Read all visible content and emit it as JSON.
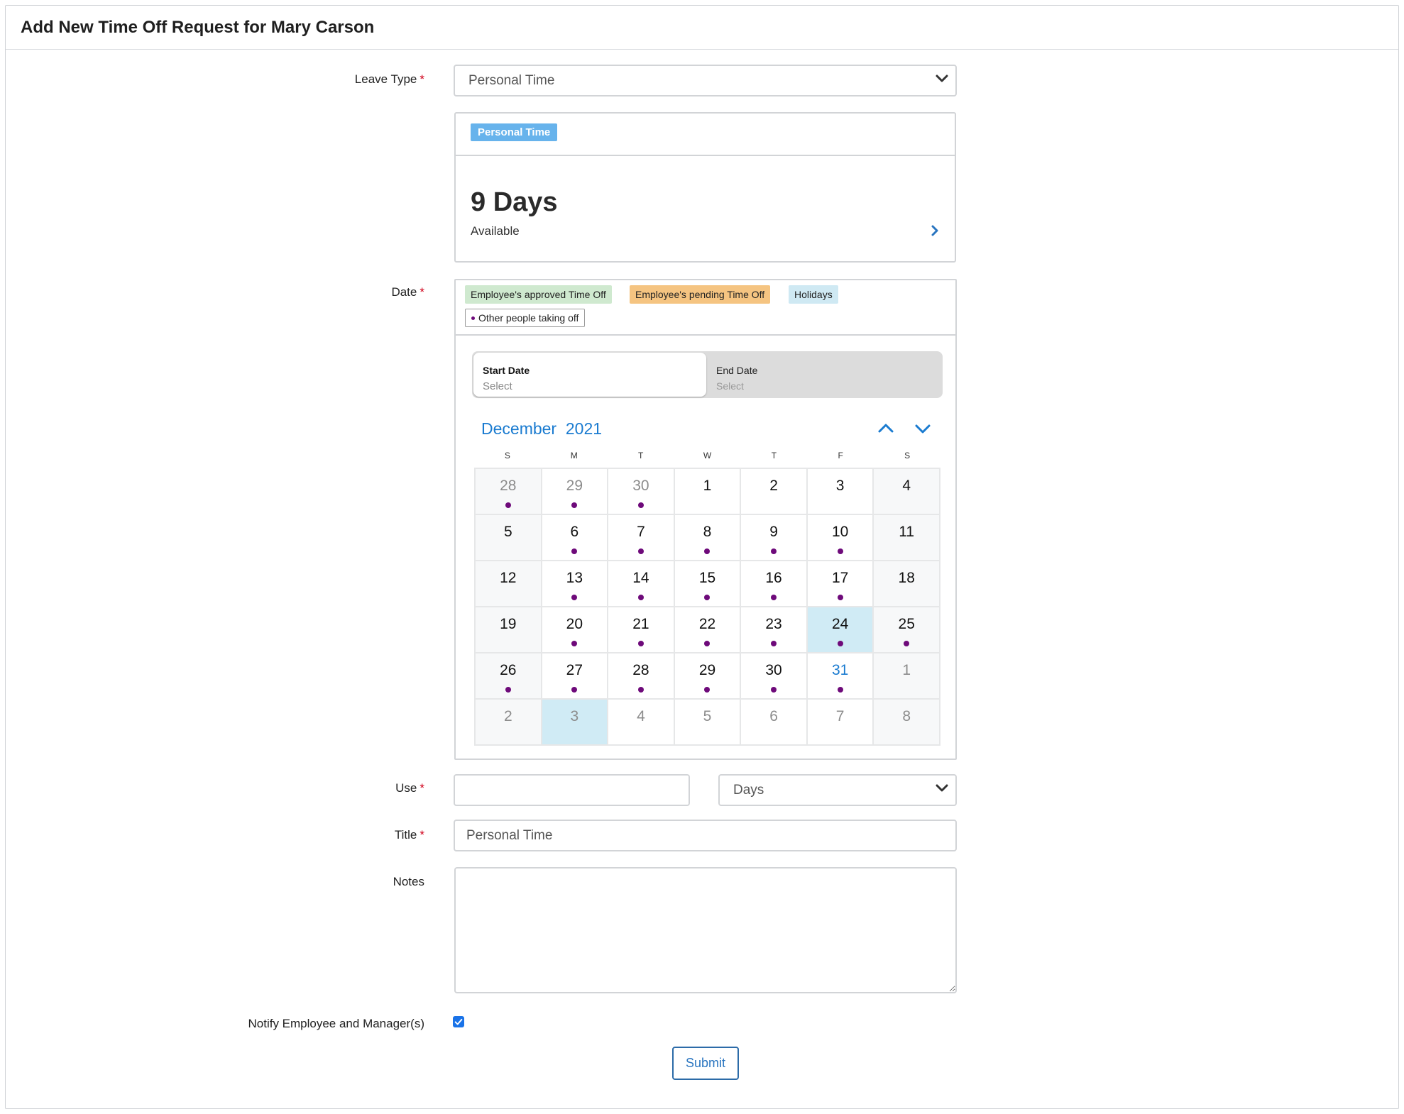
{
  "header": {
    "title": "Add New Time Off Request for Mary Carson"
  },
  "leave_type": {
    "label": "Leave Type",
    "required_mark": "*",
    "selected": "Personal Time"
  },
  "balance": {
    "badge": "Personal Time",
    "amount": "9 Days",
    "caption": "Available"
  },
  "date": {
    "label": "Date",
    "required_mark": "*",
    "legend": {
      "approved": "Employee's approved Time Off",
      "pending": "Employee's pending Time Off",
      "holidays": "Holidays",
      "others": "Other people taking off"
    },
    "start": {
      "label": "Start Date",
      "value": "Select"
    },
    "end": {
      "label": "End Date",
      "value": "Select"
    },
    "month": "December",
    "year": "2021",
    "weekdays": [
      "S",
      "M",
      "T",
      "W",
      "T",
      "F",
      "S"
    ],
    "days": [
      {
        "d": "28",
        "other": true,
        "dot": true
      },
      {
        "d": "29",
        "other": true,
        "dot": true
      },
      {
        "d": "30",
        "other": true,
        "dot": true
      },
      {
        "d": "1",
        "dot": false
      },
      {
        "d": "2",
        "dot": false
      },
      {
        "d": "3",
        "dot": false
      },
      {
        "d": "4",
        "dot": false
      },
      {
        "d": "5",
        "dot": false
      },
      {
        "d": "6",
        "dot": true
      },
      {
        "d": "7",
        "dot": true
      },
      {
        "d": "8",
        "dot": true
      },
      {
        "d": "9",
        "dot": true
      },
      {
        "d": "10",
        "dot": true
      },
      {
        "d": "11",
        "dot": false
      },
      {
        "d": "12",
        "dot": false
      },
      {
        "d": "13",
        "dot": true
      },
      {
        "d": "14",
        "dot": true
      },
      {
        "d": "15",
        "dot": true
      },
      {
        "d": "16",
        "dot": true
      },
      {
        "d": "17",
        "dot": true
      },
      {
        "d": "18",
        "dot": false
      },
      {
        "d": "19",
        "dot": false
      },
      {
        "d": "20",
        "dot": true
      },
      {
        "d": "21",
        "dot": true
      },
      {
        "d": "22",
        "dot": true
      },
      {
        "d": "23",
        "dot": true
      },
      {
        "d": "24",
        "dot": true,
        "holiday": true
      },
      {
        "d": "25",
        "dot": true
      },
      {
        "d": "26",
        "dot": true
      },
      {
        "d": "27",
        "dot": true
      },
      {
        "d": "28",
        "dot": true
      },
      {
        "d": "29",
        "dot": true
      },
      {
        "d": "30",
        "dot": true
      },
      {
        "d": "31",
        "dot": true,
        "today": true
      },
      {
        "d": "1",
        "other": true,
        "dot": false
      },
      {
        "d": "2",
        "other": true,
        "dot": false
      },
      {
        "d": "3",
        "other": true,
        "dot": false,
        "holiday": true
      },
      {
        "d": "4",
        "other": true,
        "dot": false
      },
      {
        "d": "5",
        "other": true,
        "dot": false
      },
      {
        "d": "6",
        "other": true,
        "dot": false
      },
      {
        "d": "7",
        "other": true,
        "dot": false
      },
      {
        "d": "8",
        "other": true,
        "dot": false
      }
    ]
  },
  "use": {
    "label": "Use",
    "required_mark": "*",
    "value": "",
    "unit": "Days"
  },
  "title_field": {
    "label": "Title",
    "required_mark": "*",
    "value": "Personal Time"
  },
  "notes": {
    "label": "Notes",
    "value": ""
  },
  "notify": {
    "label": "Notify Employee and Manager(s)",
    "checked": true
  },
  "submit_label": "Submit",
  "colors": {
    "accent": "#1a7bd0",
    "dot": "#6e0a7a",
    "holiday": "#d0ebf5",
    "approved": "#cfe9cf",
    "pending": "#f5c481",
    "badge": "#67b3ec"
  }
}
